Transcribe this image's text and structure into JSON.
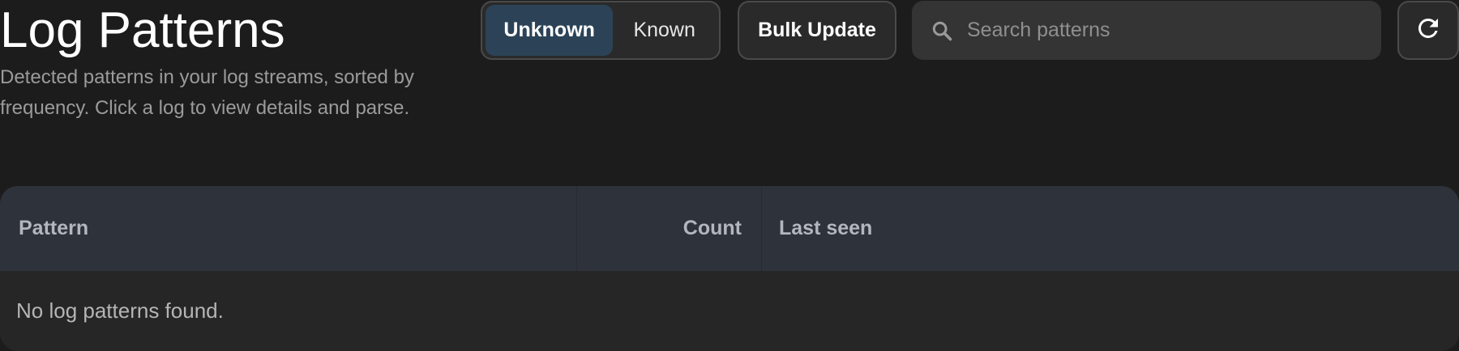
{
  "header": {
    "title": "Log Patterns",
    "subtitle": "Detected patterns in your log streams, sorted by frequency. Click a log to view details and parse."
  },
  "filter": {
    "options": [
      {
        "label": "Unknown",
        "active": true
      },
      {
        "label": "Known",
        "active": false
      }
    ]
  },
  "toolbar": {
    "bulk_update_label": "Bulk Update",
    "refresh_icon": "refresh-icon"
  },
  "search": {
    "placeholder": "Search patterns",
    "value": "",
    "icon": "search-icon"
  },
  "table": {
    "columns": [
      "Pattern",
      "Count",
      "Last seen"
    ],
    "empty_message": "No log patterns found."
  },
  "colors": {
    "background": "#1c1c1c",
    "active_toggle": "#2c4357",
    "table_header": "#2e323b",
    "table_body": "#262626"
  }
}
